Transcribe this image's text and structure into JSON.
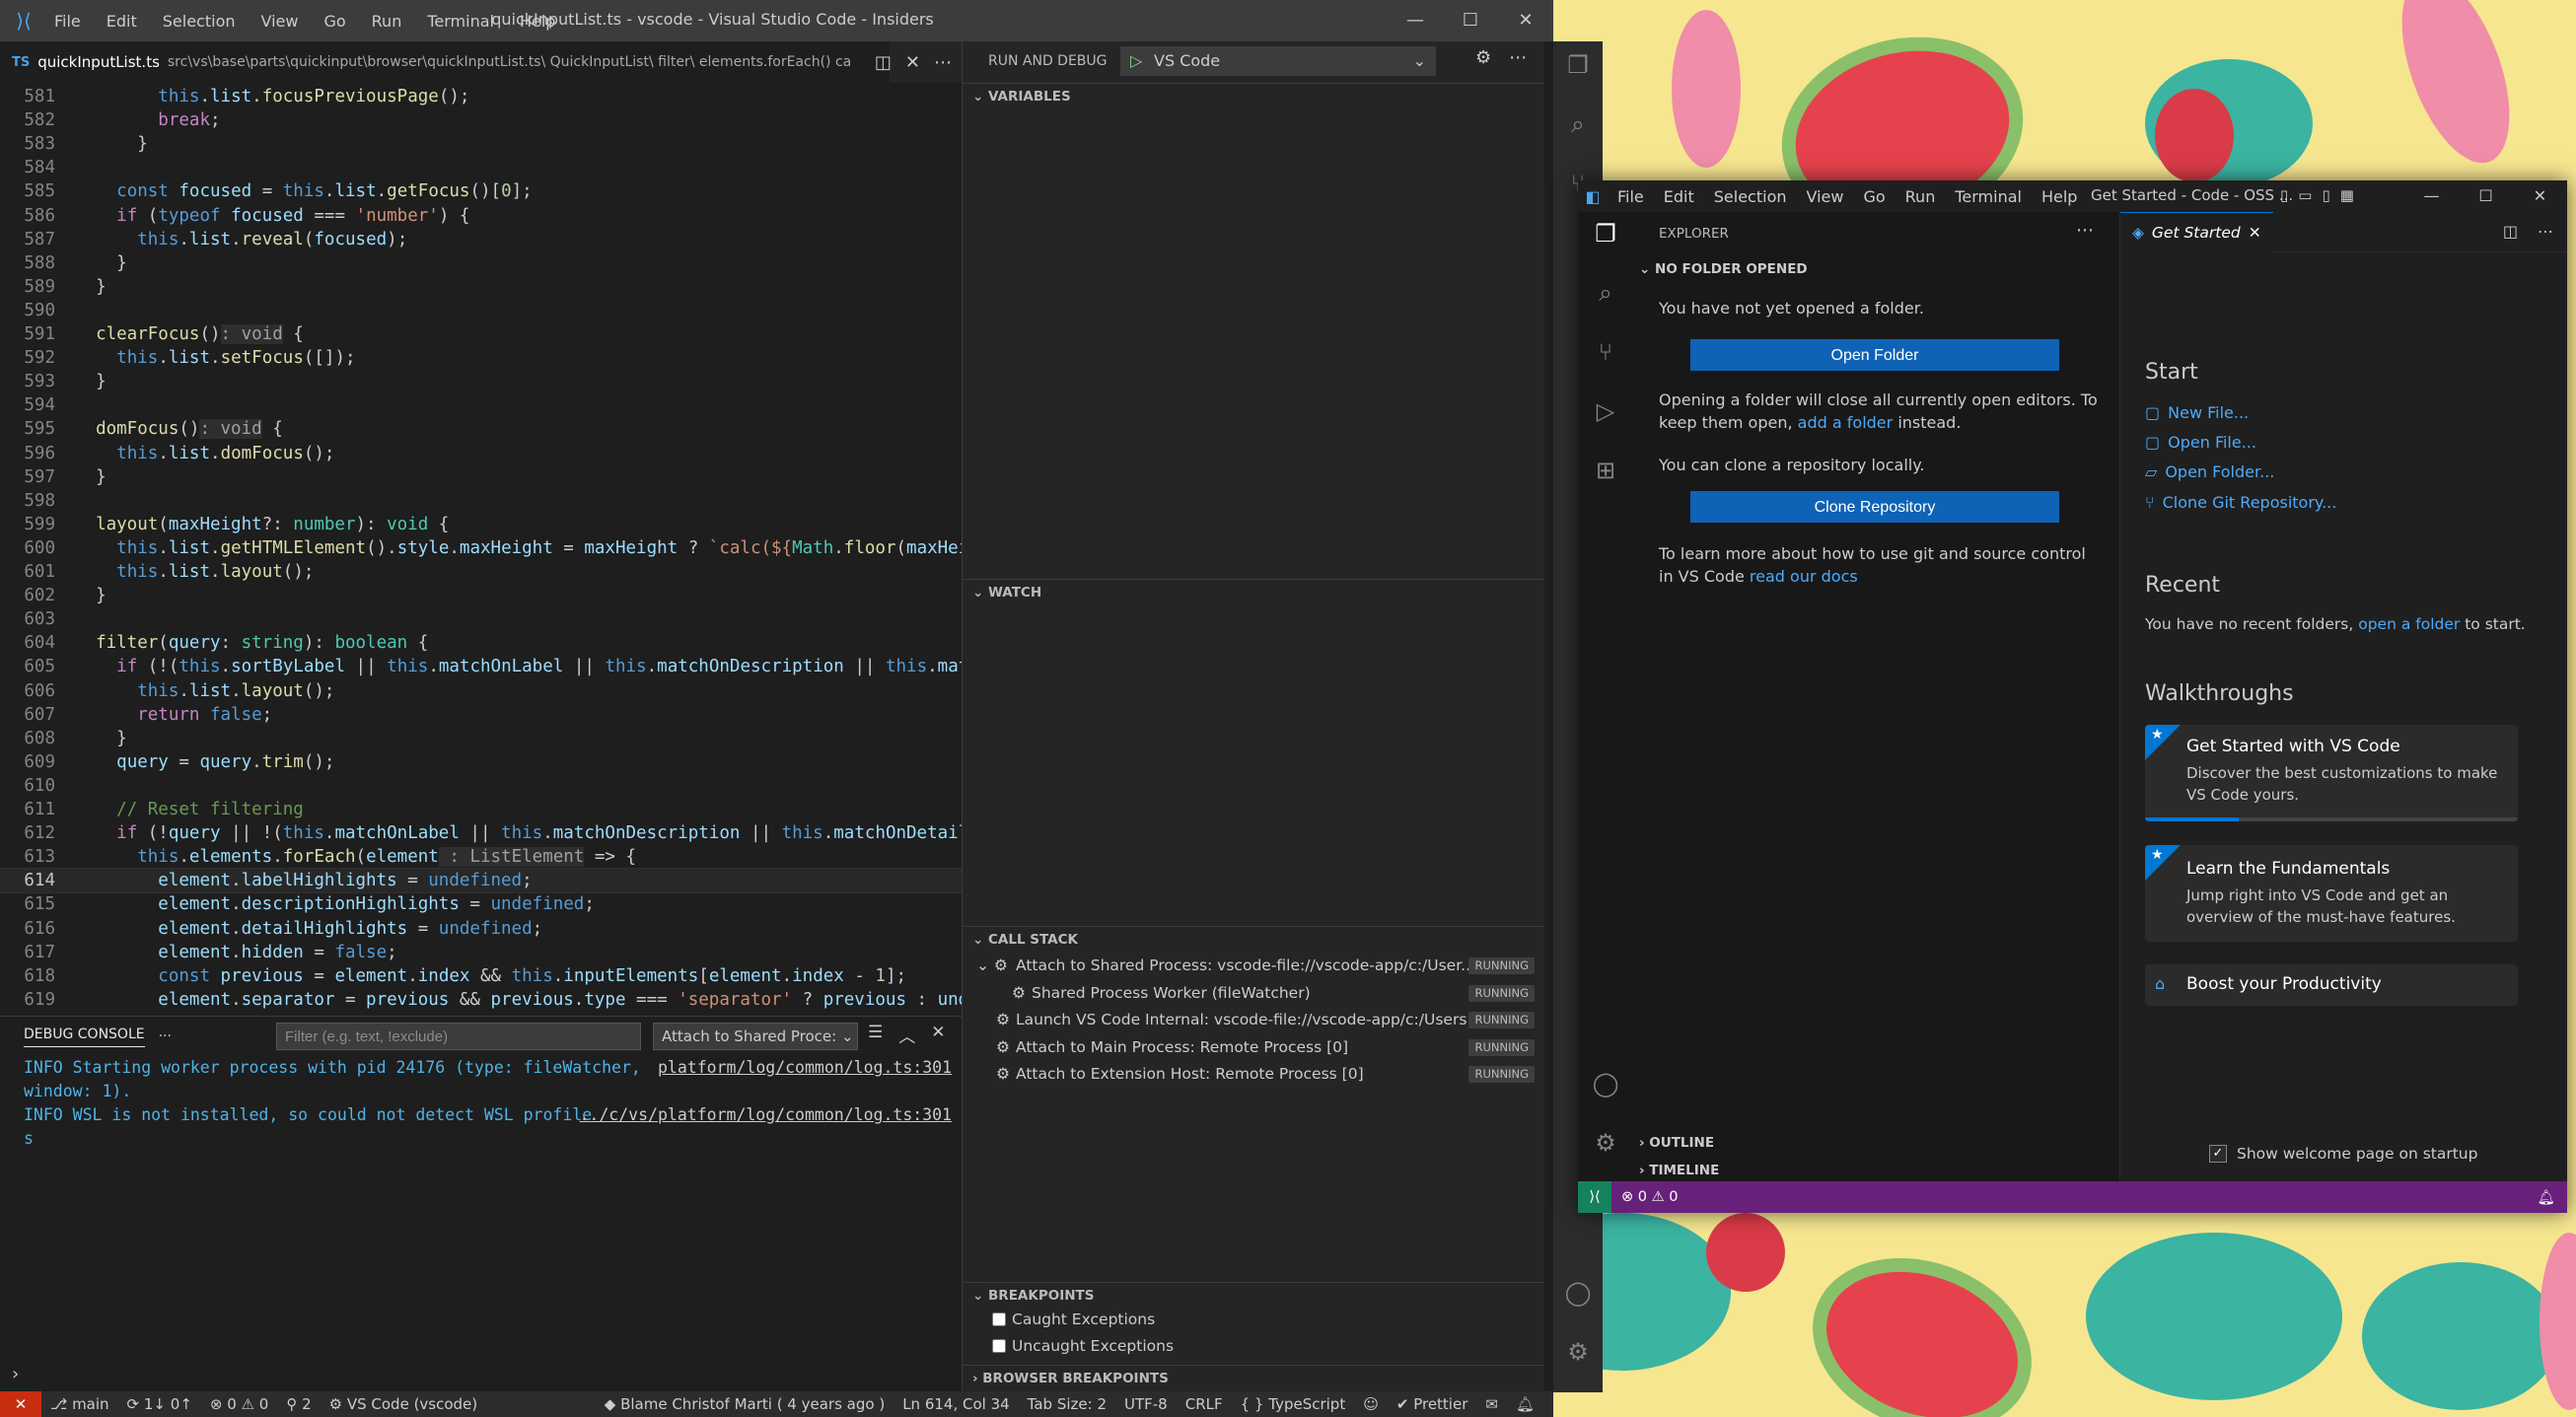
{
  "main_window": {
    "menu": [
      "File",
      "Edit",
      "Selection",
      "View",
      "Go",
      "Run",
      "Terminal",
      "Help"
    ],
    "title": "quickInputList.ts - vscode - Visual Studio Code - Insiders",
    "tab": {
      "badge": "TS",
      "name": "quickInputList.ts",
      "breadcrumb": "src\\vs\\base\\parts\\quickinput\\browser\\quickInputList.ts\\ QuickInputList\\ filter\\ elements.forEach() ca"
    },
    "code_lines": [
      {
        "n": "581",
        "html": "        <span class=\"k2\">this</span>.<span class=\"vr\">list</span>.<span class=\"fn\">focusPreviousPage</span>();"
      },
      {
        "n": "582",
        "html": "        <span class=\"kw\">break</span>;"
      },
      {
        "n": "583",
        "html": "      }"
      },
      {
        "n": "584",
        "html": ""
      },
      {
        "n": "585",
        "html": "    <span class=\"k2\">const</span> <span class=\"vr\">focused</span> = <span class=\"k2\">this</span>.<span class=\"vr\">list</span>.<span class=\"fn\">getFocus</span>()[<span class=\"nu\">0</span>];"
      },
      {
        "n": "586",
        "html": "    <span class=\"kw\">if</span> (<span class=\"k2\">typeof</span> <span class=\"vr\">focused</span> === <span class=\"st\">'number'</span>) {"
      },
      {
        "n": "587",
        "html": "      <span class=\"k2\">this</span>.<span class=\"vr\">list</span>.<span class=\"fn\">reveal</span>(<span class=\"vr\">focused</span>);"
      },
      {
        "n": "588",
        "html": "    }"
      },
      {
        "n": "589",
        "html": "  }"
      },
      {
        "n": "590",
        "html": ""
      },
      {
        "n": "591",
        "html": "  <span class=\"fn\">clearFocus</span>()<span class=\"hint\">: void</span> {"
      },
      {
        "n": "592",
        "html": "    <span class=\"k2\">this</span>.<span class=\"vr\">list</span>.<span class=\"fn\">setFocus</span>([]);"
      },
      {
        "n": "593",
        "html": "  }"
      },
      {
        "n": "594",
        "html": ""
      },
      {
        "n": "595",
        "html": "  <span class=\"fn\">domFocus</span>()<span class=\"hint\">: void</span> {"
      },
      {
        "n": "596",
        "html": "    <span class=\"k2\">this</span>.<span class=\"vr\">list</span>.<span class=\"fn\">domFocus</span>();"
      },
      {
        "n": "597",
        "html": "  }"
      },
      {
        "n": "598",
        "html": ""
      },
      {
        "n": "599",
        "html": "  <span class=\"fn\">layout</span>(<span class=\"vr\">maxHeight</span>?: <span class=\"ty\">number</span>): <span class=\"ty\">void</span> {"
      },
      {
        "n": "600",
        "html": "    <span class=\"k2\">this</span>.<span class=\"vr\">list</span>.<span class=\"fn\">getHTMLElement</span>().<span class=\"vr\">style</span>.<span class=\"vr\">maxHeight</span> = <span class=\"vr\">maxHeight</span> ? <span class=\"st\">`calc(${</span><span class=\"ty\">Math</span>.<span class=\"fn\">floor</span>(<span class=\"vr\">maxHeigh</span>"
      },
      {
        "n": "601",
        "html": "    <span class=\"k2\">this</span>.<span class=\"vr\">list</span>.<span class=\"fn\">layout</span>();"
      },
      {
        "n": "602",
        "html": "  }"
      },
      {
        "n": "603",
        "html": ""
      },
      {
        "n": "604",
        "html": "  <span class=\"fn\">filter</span>(<span class=\"vr\">query</span>: <span class=\"ty\">string</span>): <span class=\"ty\">boolean</span> {"
      },
      {
        "n": "605",
        "html": "    <span class=\"kw\">if</span> (!(<span class=\"k2\">this</span>.<span class=\"vr\">sortByLabel</span> || <span class=\"k2\">this</span>.<span class=\"vr\">matchOnLabel</span> || <span class=\"k2\">this</span>.<span class=\"vr\">matchOnDescription</span> || <span class=\"k2\">this</span>.<span class=\"vr\">matchO</span>"
      },
      {
        "n": "606",
        "html": "      <span class=\"k2\">this</span>.<span class=\"vr\">list</span>.<span class=\"fn\">layout</span>();"
      },
      {
        "n": "607",
        "html": "      <span class=\"kw\">return</span> <span class=\"k2\">false</span>;"
      },
      {
        "n": "608",
        "html": "    }"
      },
      {
        "n": "609",
        "html": "    <span class=\"vr\">query</span> = <span class=\"vr\">query</span>.<span class=\"fn\">trim</span>();"
      },
      {
        "n": "610",
        "html": ""
      },
      {
        "n": "611",
        "html": "    <span class=\"cm\">// Reset filtering</span>"
      },
      {
        "n": "612",
        "html": "    <span class=\"kw\">if</span> (!<span class=\"vr\">query</span> || !(<span class=\"k2\">this</span>.<span class=\"vr\">matchOnLabel</span> || <span class=\"k2\">this</span>.<span class=\"vr\">matchOnDescription</span> || <span class=\"k2\">this</span>.<span class=\"vr\">matchOnDetail</span>))"
      },
      {
        "n": "613",
        "html": "      <span class=\"k2\">this</span>.<span class=\"vr\">elements</span>.<span class=\"fn\">forEach</span>(<span class=\"vr\">element</span><span class=\"hint\"> : ListElement</span> => {"
      },
      {
        "n": "614",
        "html": "        <span class=\"vr\">element</span>.<span class=\"vr\">labelHighlights</span> = <span class=\"k2\">undefined</span>;",
        "current": true
      },
      {
        "n": "615",
        "html": "        <span class=\"vr\">element</span>.<span class=\"vr\">descriptionHighlights</span> = <span class=\"k2\">undefined</span>;"
      },
      {
        "n": "616",
        "html": "        <span class=\"vr\">element</span>.<span class=\"vr\">detailHighlights</span> = <span class=\"k2\">undefined</span>;"
      },
      {
        "n": "617",
        "html": "        <span class=\"vr\">element</span>.<span class=\"vr\">hidden</span> = <span class=\"k2\">false</span>;"
      },
      {
        "n": "618",
        "html": "        <span class=\"k2\">const</span> <span class=\"vr\">previous</span> = <span class=\"vr\">element</span>.<span class=\"vr\">index</span> && <span class=\"k2\">this</span>.<span class=\"vr\">inputElements</span>[<span class=\"vr\">element</span>.<span class=\"vr\">index</span> - <span class=\"nu\">1</span>];"
      },
      {
        "n": "619",
        "html": "        <span class=\"vr\">element</span>.<span class=\"vr\">separator</span> = <span class=\"vr\">previous</span> && <span class=\"vr\">previous</span>.<span class=\"vr\">type</span> === <span class=\"st\">'separator'</span> ? <span class=\"vr\">previous</span> : <span class=\"vr\">undef</span>"
      }
    ],
    "debug_console": {
      "title": "DEBUG CONSOLE",
      "more": "···",
      "filter_placeholder": "Filter (e.g. text, !exclude)",
      "session": "Attach to Shared Proce:",
      "lines": [
        {
          "text": "INFO Starting worker process with pid 24176 (type: fileWatcher,",
          "source": "platform/log/common/log.ts:301"
        },
        {
          "text": "window: 1).",
          "source": ""
        },
        {
          "text": "INFO WSL is not installed, so could not detect WSL profile",
          "source": "../c/vs/platform/log/common/log.ts:301"
        },
        {
          "text": "s",
          "source": ""
        }
      ]
    },
    "run_and_debug": {
      "title": "RUN AND DEBUG",
      "config": "VS Code",
      "sections": {
        "variables": "VARIABLES",
        "watch": "WATCH",
        "call_stack": "CALL STACK",
        "breakpoints": "BREAKPOINTS",
        "browser_breakpoints": "BROWSER BREAKPOINTS"
      },
      "call_stack": [
        {
          "label": "Attach to Shared Process: vscode-file://vscode-app/c:/User...",
          "status": "RUNNING",
          "indent": 0
        },
        {
          "label": "Shared Process Worker (fileWatcher)",
          "status": "RUNNING",
          "indent": 1
        },
        {
          "label": "Launch VS Code Internal: vscode-file://vscode-app/c:/Users...",
          "status": "RUNNING",
          "indent": 0
        },
        {
          "label": "Attach to Main Process: Remote Process [0]",
          "status": "RUNNING",
          "indent": 0
        },
        {
          "label": "Attach to Extension Host: Remote Process [0]",
          "status": "RUNNING",
          "indent": 0
        }
      ],
      "breakpoints": [
        "Caught Exceptions",
        "Uncaught Exceptions"
      ]
    },
    "status": {
      "branch": "main",
      "sync": "1↓ 0↑",
      "problems": "⊗ 0 ⚠ 0",
      "ports": "2",
      "debug": "VS Code (vscode)",
      "blame": "Blame Christof Marti ( 4 years ago )",
      "position": "Ln 614, Col 34",
      "tab_size": "Tab Size: 2",
      "encoding": "UTF-8",
      "eol": "CRLF",
      "language": "{ } TypeScript",
      "prettier": "✔ Prettier"
    }
  },
  "second_window": {
    "menu": [
      "File",
      "Edit",
      "Selection",
      "View",
      "Go",
      "Run",
      "Terminal",
      "Help"
    ],
    "title": "Get Started - Code - OSS ...",
    "explorer": {
      "title": "EXPLORER",
      "section": "NO FOLDER OPENED",
      "no_folder": "You have not yet opened a folder.",
      "open_folder_btn": "Open Folder",
      "open_msg_1": "Opening a folder will close all currently open editors. To keep them open,",
      "open_msg_link": "add a folder",
      "open_msg_2": "instead.",
      "clone_msg": "You can clone a repository locally.",
      "clone_btn": "Clone Repository",
      "learn_1": "To learn more about how to use git and source control in VS Code",
      "learn_link": "read our docs",
      "outline": "OUTLINE",
      "timeline": "TIMELINE"
    },
    "welcome": {
      "tab": "Get Started",
      "start_heading": "Start",
      "start_links": [
        "New File...",
        "Open File...",
        "Open Folder...",
        "Clone Git Repository..."
      ],
      "recent_heading": "Recent",
      "recent_text": "You have no recent folders,",
      "recent_link": "open a folder",
      "recent_text_2": "to start.",
      "walkthroughs_heading": "Walkthroughs",
      "cards": [
        {
          "title": "Get Started with VS Code",
          "desc": "Discover the best customizations to make VS Code yours.",
          "progress": 0.25
        },
        {
          "title": "Learn the Fundamentals",
          "desc": "Jump right into VS Code and get an overview of the must-have features."
        },
        {
          "title": "Boost your Productivity",
          "desc": ""
        }
      ],
      "show_on_startup": "Show welcome page on startup"
    },
    "status": {
      "problems": "⊗ 0 ⚠ 0"
    }
  }
}
